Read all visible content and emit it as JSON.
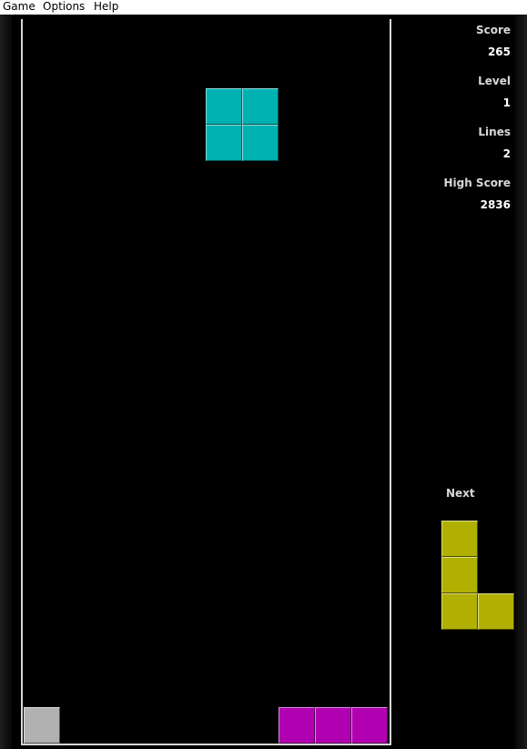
{
  "menu": {
    "game": "Game",
    "options": "Options",
    "help": "Help"
  },
  "stats": {
    "score_label": "Score",
    "score": "265",
    "level_label": "Level",
    "level": "1",
    "lines_label": "Lines",
    "lines": "2",
    "high_score_label": "High Score",
    "high_score": "2836"
  },
  "next": {
    "label": "Next",
    "piece": "L",
    "color": "#b1b000"
  },
  "current_piece": {
    "type": "O",
    "color": "#00b1b1"
  },
  "settled_blocks": [
    {
      "color": "#b1b1b1"
    },
    {
      "color": "#b100b1"
    },
    {
      "color": "#b100b1"
    },
    {
      "color": "#b100b1"
    }
  ],
  "colors": {
    "background": "#000000",
    "well_border": "#d8d8d8",
    "menubar": "#ffffff"
  }
}
